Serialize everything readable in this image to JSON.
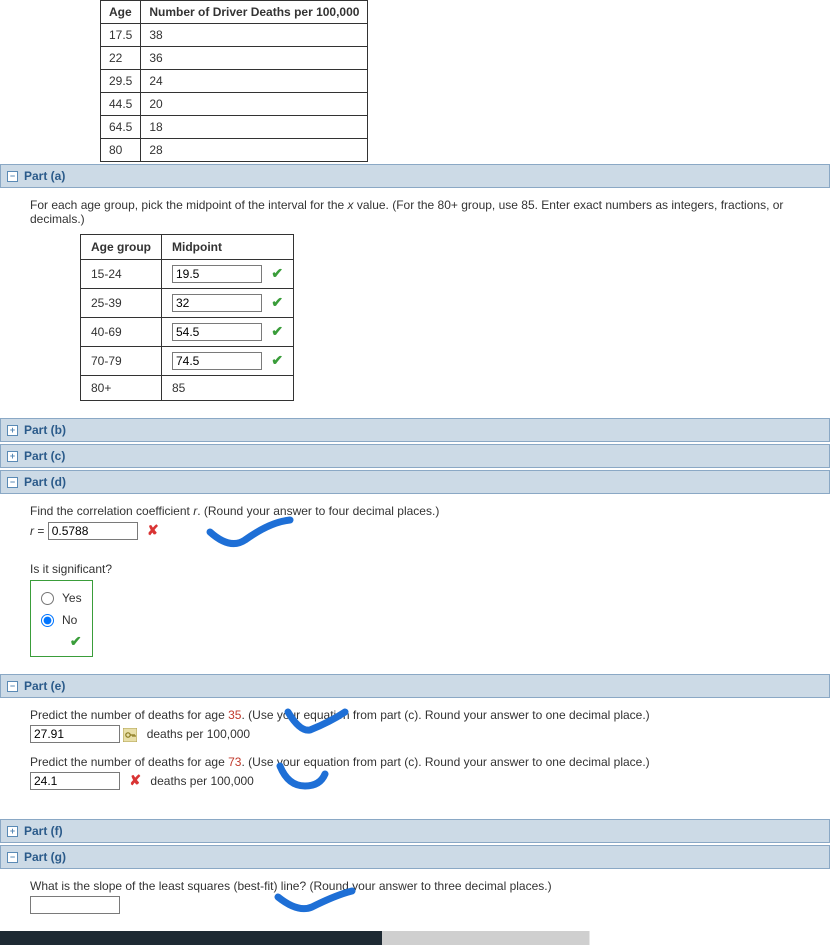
{
  "top_table": {
    "headers": {
      "age": "Age",
      "deaths": "Number of Driver Deaths per 100,000"
    },
    "rows": [
      {
        "age": "17.5",
        "deaths": "38"
      },
      {
        "age": "22",
        "deaths": "36"
      },
      {
        "age": "29.5",
        "deaths": "24"
      },
      {
        "age": "44.5",
        "deaths": "20"
      },
      {
        "age": "64.5",
        "deaths": "18"
      },
      {
        "age": "80",
        "deaths": "28"
      }
    ]
  },
  "parts": {
    "a": {
      "label": "Part (a)",
      "icon": "−"
    },
    "b": {
      "label": "Part (b)",
      "icon": "+"
    },
    "c": {
      "label": "Part (c)",
      "icon": "+"
    },
    "d": {
      "label": "Part (d)",
      "icon": "−"
    },
    "e": {
      "label": "Part (e)",
      "icon": "−"
    },
    "f": {
      "label": "Part (f)",
      "icon": "+"
    },
    "g": {
      "label": "Part (g)",
      "icon": "−"
    }
  },
  "part_a": {
    "prompt_pre": "For each age group, pick the midpoint of the interval for the ",
    "prompt_var": "x",
    "prompt_post": " value. (For the 80+ group, use 85. Enter exact numbers as integers, fractions, or decimals.)",
    "headers": {
      "group": "Age group",
      "midpoint": "Midpoint"
    },
    "rows": [
      {
        "group": "15-24",
        "value": "19.5",
        "has_input": true,
        "correct": true
      },
      {
        "group": "25-39",
        "value": "32",
        "has_input": true,
        "correct": true
      },
      {
        "group": "40-69",
        "value": "54.5",
        "has_input": true,
        "correct": true
      },
      {
        "group": "70-79",
        "value": "74.5",
        "has_input": true,
        "correct": true
      },
      {
        "group": "80+",
        "value": "85",
        "has_input": false
      }
    ]
  },
  "part_d": {
    "prompt_pre": "Find the correlation coefficient ",
    "prompt_var": "r",
    "prompt_post": ". (Round your answer to four decimal places.)",
    "r_label_pre": "r",
    "r_label_eq": " = ",
    "r_value": "0.5788",
    "significant_q": "Is it significant?",
    "yes": "Yes",
    "no": "No",
    "selected": "no"
  },
  "part_e": {
    "q1_pre": "Predict the number of deaths for age ",
    "q1_age": "35",
    "q1_post": ". (Use your equation from part (c). Round your answer to one decimal place.)",
    "q1_value": "27.91",
    "q1_units": "deaths per 100,000",
    "q2_pre": "Predict the number of deaths for age ",
    "q2_age": "73",
    "q2_post": ". (Use your equation from part (c). Round your answer to one decimal place.)",
    "q2_value": "24.1",
    "q2_units": "deaths per 100,000"
  },
  "part_g": {
    "prompt": "What is the slope of the least squares (best-fit) line? (Round your answer to three decimal places.)",
    "value": ""
  }
}
